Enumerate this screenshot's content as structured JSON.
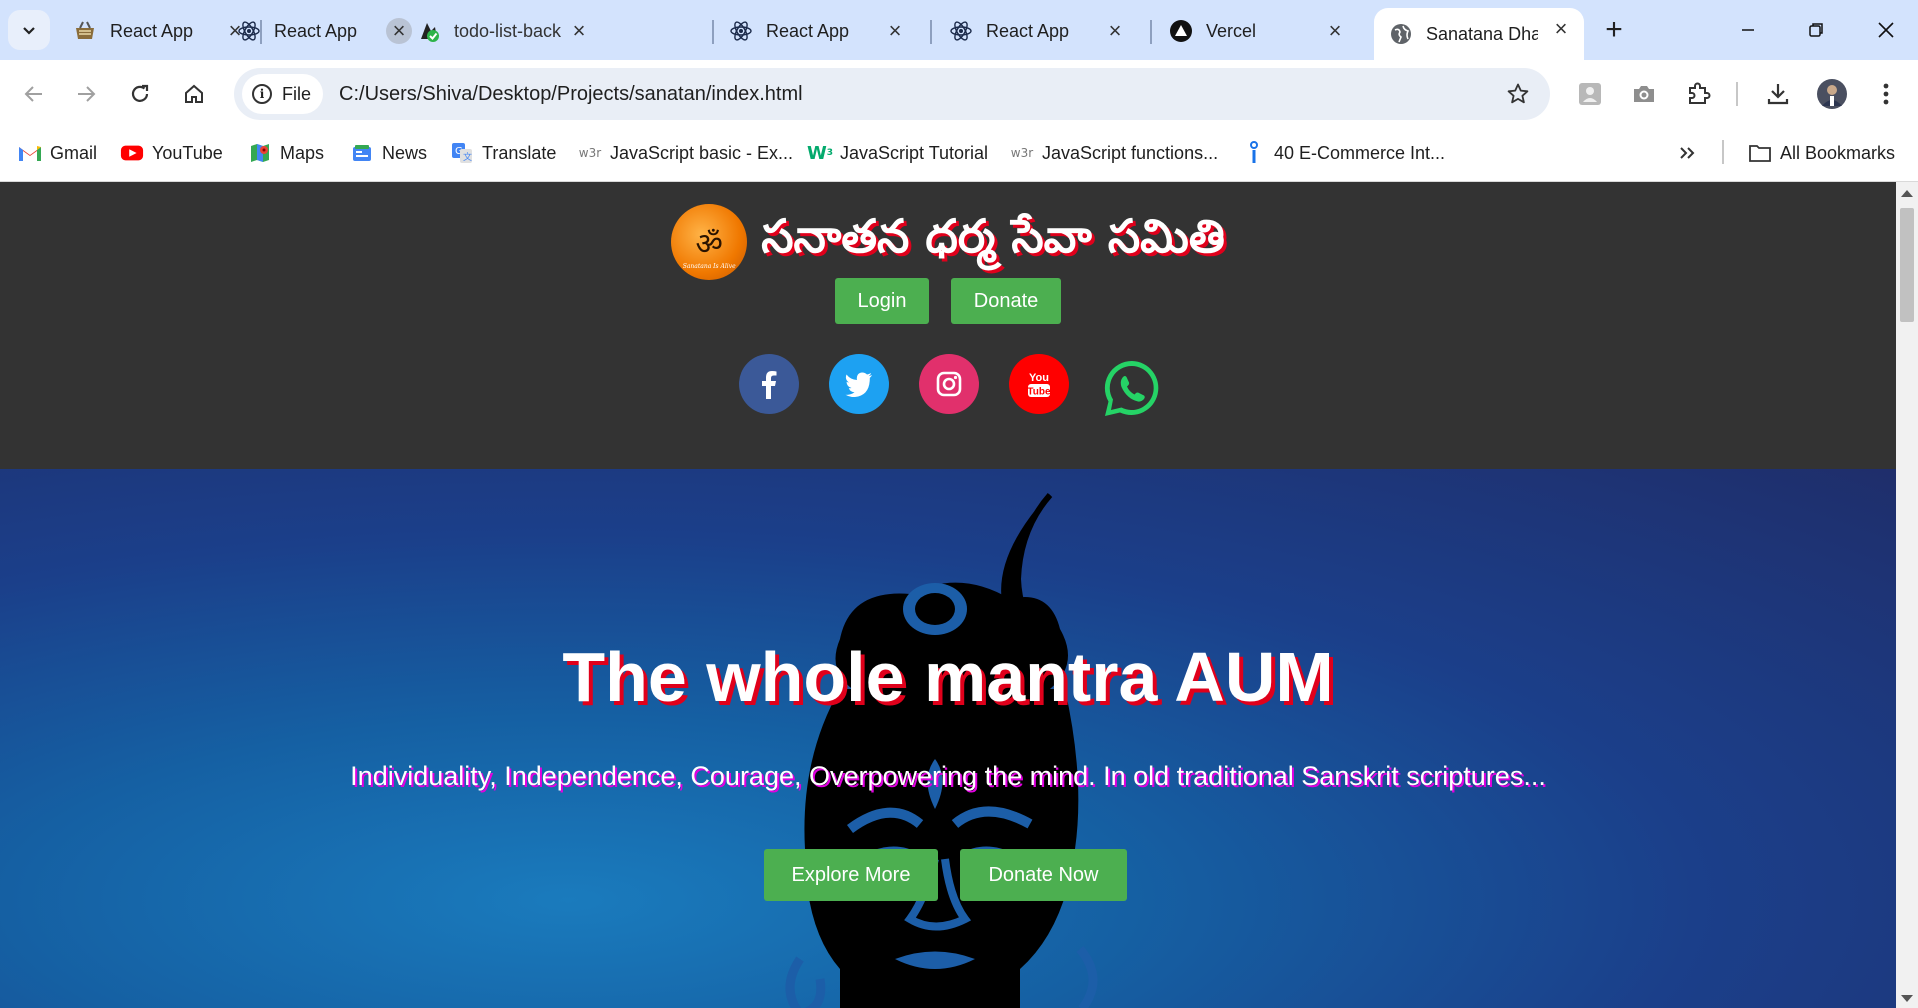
{
  "browser": {
    "tabs": [
      {
        "label": "React App",
        "icon": "basket-icon"
      },
      {
        "label": "React App",
        "icon": "react-icon"
      },
      {
        "label": "todo-list-back",
        "icon": "deploy-check-icon"
      },
      {
        "label": "React App",
        "icon": "react-icon"
      },
      {
        "label": "React App",
        "icon": "react-icon"
      },
      {
        "label": "Vercel",
        "icon": "vercel-icon"
      },
      {
        "label": "Sanatana Dha",
        "icon": "globe-icon",
        "active": true
      }
    ],
    "address": {
      "chip": "File",
      "url": "C:/Users/Shiva/Desktop/Projects/sanatan/index.html"
    },
    "bookmarks": [
      {
        "label": "Gmail",
        "icon": "gmail-icon"
      },
      {
        "label": "YouTube",
        "icon": "youtube-icon"
      },
      {
        "label": "Maps",
        "icon": "maps-icon"
      },
      {
        "label": "News",
        "icon": "news-icon"
      },
      {
        "label": "Translate",
        "icon": "translate-icon"
      },
      {
        "label": "JavaScript basic - Ex...",
        "icon": "w3r-icon"
      },
      {
        "label": "JavaScript Tutorial",
        "icon": "w3-icon"
      },
      {
        "label": "JavaScript functions...",
        "icon": "w3r-icon"
      },
      {
        "label": "40 E-Commerce Int...",
        "icon": "info-icon"
      }
    ],
    "all_bookmarks": "All Bookmarks"
  },
  "site": {
    "logo_caption": "Sanatana Is Alive",
    "title": "సనాతన ధర్మ సేవా సమితి",
    "login": "Login",
    "donate": "Donate",
    "socials": [
      "facebook",
      "twitter",
      "instagram",
      "youtube",
      "whatsapp"
    ],
    "hero_title": "The whole mantra AUM",
    "hero_subtitle": "Individuality, Independence, Courage, Overpowering the mind. In old traditional Sanskrit scriptures...",
    "explore": "Explore More",
    "donate_now": "Donate Now"
  },
  "colors": {
    "header_bg": "#333333",
    "button_green": "#4caf50",
    "title_shadow": "#e0001b",
    "subtitle_shadow": "#e000e0",
    "tabstrip": "#d3e3fd"
  }
}
